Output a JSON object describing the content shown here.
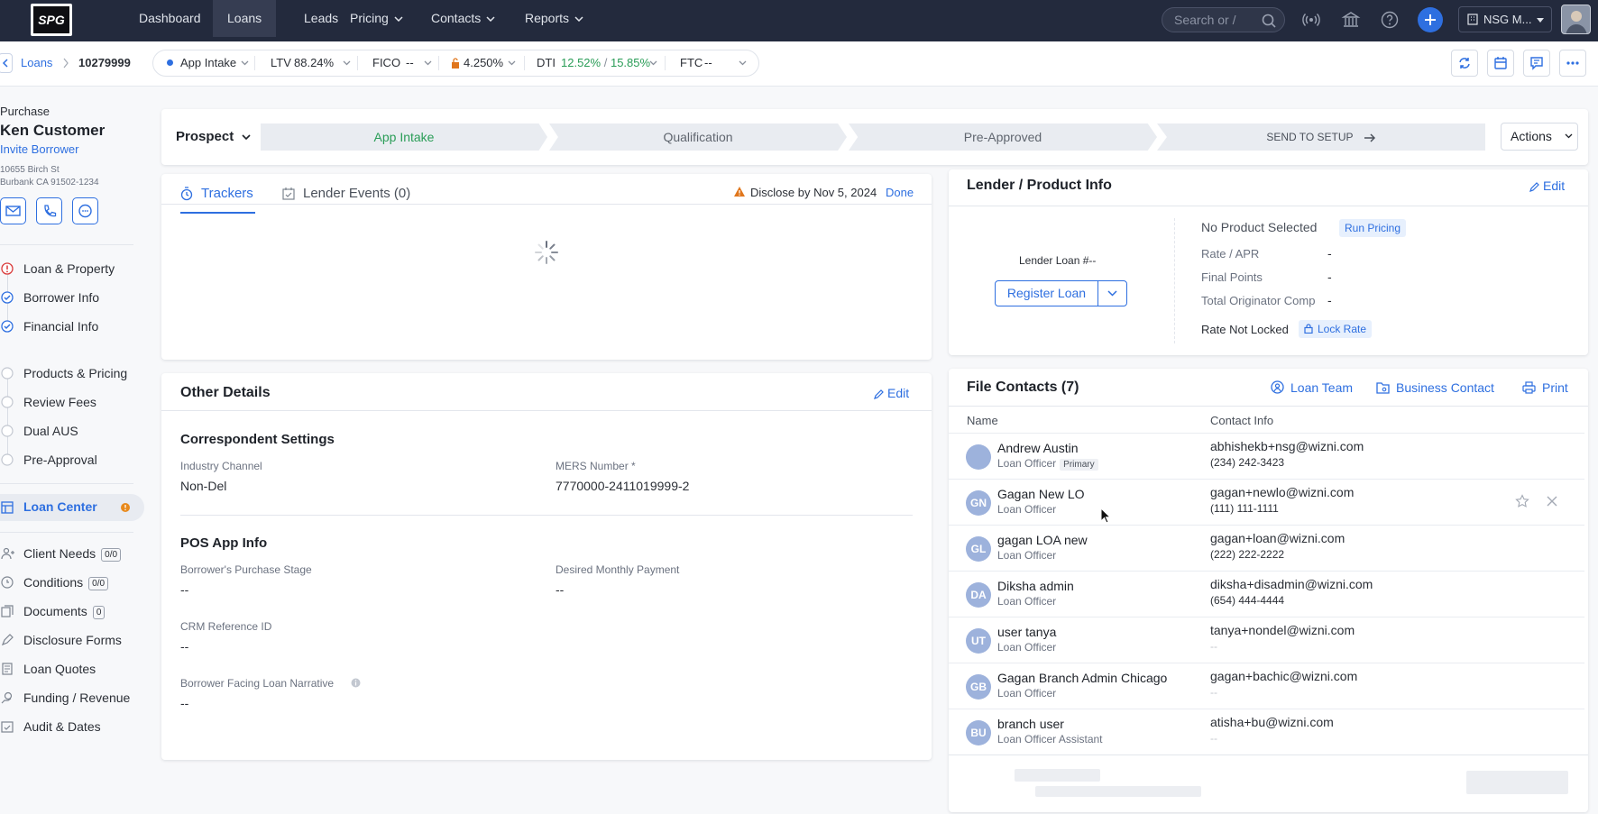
{
  "topnav": {
    "logo_text": "SPG",
    "items": [
      {
        "label": "Dashboard"
      },
      {
        "label": "Loans"
      },
      {
        "label": "Leads"
      },
      {
        "label": "Pricing"
      },
      {
        "label": "Contacts"
      },
      {
        "label": "Reports"
      }
    ],
    "search_placeholder": "Search or /",
    "org": "NSG M..."
  },
  "subbar": {
    "breadcrumb": "Loans",
    "loan_number": "10279999",
    "status": "App Intake",
    "ltv_label": "LTV",
    "ltv_value": "88.24%",
    "fico_label": "FICO",
    "fico_value": "--",
    "rate_value": "4.250%",
    "dti_label": "DTI",
    "dti_value1": "12.52%",
    "dti_sep": "/",
    "dti_value2": "15.85%",
    "ftc_label": "FTC",
    "ftc_value": "--"
  },
  "borrower": {
    "purpose": "Purchase",
    "name": "Ken Customer",
    "invite": "Invite Borrower",
    "addr1": "10655 Birch St",
    "addr2": "Burbank CA 91502-1234"
  },
  "sidebar": {
    "steps": [
      {
        "label": "Loan & Property",
        "status": "error"
      },
      {
        "label": "Borrower Info",
        "status": "done"
      },
      {
        "label": "Financial Info",
        "status": "done"
      }
    ],
    "steps2": [
      {
        "label": "Products & Pricing"
      },
      {
        "label": "Review Fees"
      },
      {
        "label": "Dual AUS"
      },
      {
        "label": "Pre-Approval"
      }
    ],
    "loan_center": "Loan Center",
    "tools": [
      {
        "label": "Client Needs",
        "count": "0/0"
      },
      {
        "label": "Conditions",
        "count": "0/0"
      },
      {
        "label": "Documents",
        "count": "0"
      },
      {
        "label": "Disclosure Forms"
      },
      {
        "label": "Loan Quotes"
      },
      {
        "label": "Funding / Revenue"
      },
      {
        "label": "Audit & Dates"
      }
    ]
  },
  "stages": {
    "prospect": "Prospect",
    "items": [
      "App Intake",
      "Qualification",
      "Pre-Approved"
    ],
    "send": "SEND TO SETUP",
    "actions": "Actions"
  },
  "trackers": {
    "tab1": "Trackers",
    "tab2": "Lender Events (0)",
    "disclose": "Disclose by Nov 5, 2024",
    "done": "Done"
  },
  "other": {
    "title": "Other Details",
    "edit": "Edit",
    "section1": "Correspondent Settings",
    "industry_label": "Industry Channel",
    "industry_value": "Non-Del",
    "mers_label": "MERS Number *",
    "mers_value": "7770000-2411019999-2",
    "section2": "POS App Info",
    "stage_label": "Borrower's Purchase Stage",
    "stage_value": "--",
    "payment_label": "Desired Monthly Payment",
    "payment_value": "--",
    "crm_label": "CRM Reference ID",
    "crm_value": "--",
    "narrative_label": "Borrower Facing Loan Narrative",
    "narrative_value": "--"
  },
  "lender": {
    "title": "Lender / Product Info",
    "edit": "Edit",
    "loan_no": "Lender Loan #--",
    "register": "Register Loan",
    "no_product": "No Product Selected",
    "run_pricing": "Run Pricing",
    "rate_label": "Rate / APR",
    "rate_value": "-",
    "points_label": "Final Points",
    "points_value": "-",
    "comp_label": "Total Originator Comp",
    "comp_value": "-",
    "lock_status": "Rate Not Locked",
    "lock_btn": "Lock Rate"
  },
  "contacts": {
    "title": "File Contacts (7)",
    "loan_team": "Loan Team",
    "business": "Business Contact",
    "print": "Print",
    "col_name": "Name",
    "col_info": "Contact Info",
    "primary": "Primary",
    "rows": [
      {
        "initials": "",
        "name": "Andrew Austin",
        "role": "Loan Officer",
        "email": "abhishekb+nsg@wizni.com",
        "phone": "(234) 242-3423"
      },
      {
        "initials": "GN",
        "name": "Gagan New LO",
        "role": "Loan Officer",
        "email": "gagan+newlo@wizni.com",
        "phone": "(111) 111-1111"
      },
      {
        "initials": "GL",
        "name": "gagan LOA new",
        "role": "Loan Officer",
        "email": "gagan+loan@wizni.com",
        "phone": "(222) 222-2222"
      },
      {
        "initials": "DA",
        "name": "Diksha admin",
        "role": "Loan Officer",
        "email": "diksha+disadmin@wizni.com",
        "phone": "(654) 444-4444"
      },
      {
        "initials": "UT",
        "name": "user tanya",
        "role": "Loan Officer",
        "email": "tanya+nondel@wizni.com",
        "phone": "--"
      },
      {
        "initials": "GB",
        "name": "Gagan Branch Admin Chicago",
        "role": "Loan Officer",
        "email": "gagan+bachic@wizni.com",
        "phone": "--"
      },
      {
        "initials": "BU",
        "name": "branch user",
        "role": "Loan Officer Assistant",
        "email": "atisha+bu@wizni.com",
        "phone": "--"
      }
    ]
  },
  "colors": {
    "nav_bg": "#232a3d",
    "accent": "#2e6fe0",
    "success": "#2a9d57",
    "warning": "#e0761c",
    "error": "#d93a3a"
  }
}
